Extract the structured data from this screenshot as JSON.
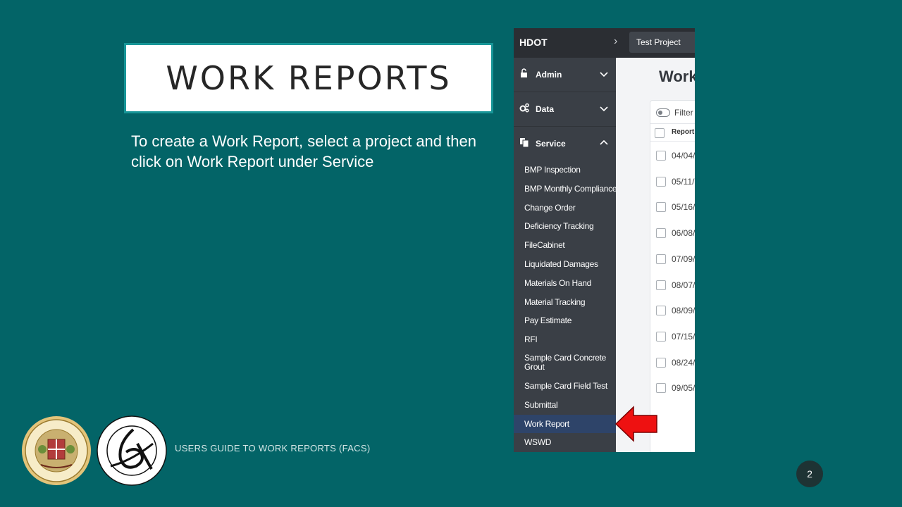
{
  "slide": {
    "title": "WORK REPORTS",
    "instruction": "To create a Work Report, select a project and then click on Work Report under Service",
    "footer": "USERS GUIDE TO WORK REPORTS (FACS)",
    "page_number": "2"
  },
  "app": {
    "brand": "HDOT",
    "project": "Test Project",
    "groups": [
      {
        "label": "Admin",
        "icon": "lock-icon"
      },
      {
        "label": "Data",
        "icon": "gears-icon"
      },
      {
        "label": "Service",
        "icon": "documents-icon"
      }
    ],
    "service_items": [
      "BMP Inspection",
      "BMP Monthly Compliance",
      "Change Order",
      "Deficiency Tracking",
      "FileCabinet",
      "Liquidated Damages",
      "Materials On Hand",
      "Material Tracking",
      "Pay Estimate",
      "RFI",
      "Sample Card Concrete Grout",
      "Sample Card Field Test",
      "Submittal",
      "Work Report",
      "WSWD"
    ],
    "active_item": "Work Report",
    "main_title": "Work",
    "filter_label": "Filter",
    "column_header": "Report",
    "rows": [
      "04/04/",
      "05/11/",
      "05/16/",
      "06/08/",
      "07/09/",
      "08/07/",
      "08/09/",
      "07/15/",
      "08/24/",
      "09/05/"
    ]
  },
  "colors": {
    "background": "#036467",
    "title_border": "#179597",
    "sidebar": "#3a3f46",
    "active": "#2e4469",
    "arrow": "#ee1111"
  }
}
